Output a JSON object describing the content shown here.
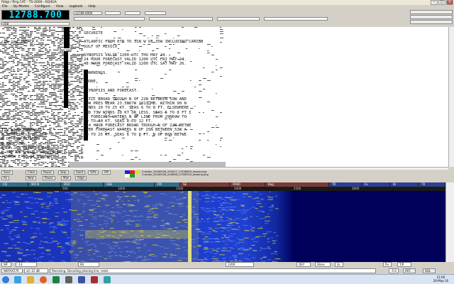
{
  "window": {
    "title": "fldigi / flrig CAT - TS-2000 - KQ4GA"
  },
  "menu": [
    "File",
    "Op Modes",
    "Configure",
    "View",
    "Logbook",
    "Help"
  ],
  "frequency": {
    "display": "12788.700",
    "mode": "USB",
    "field_freq": "12789.0000"
  },
  "faxtext": {
    "left_a": [
      "CAN SEA AND",
      "",
      "",
      "",
      "",
      "",
      "",
      "",
      "",
      "",
      "",
      "",
      "",
      "",
      "",
      "",
      "",
      "",
      "",
      "",
      "TIN WITH EMBEDDED",
      "N SEMICIRCLE OF LOW",
      "N OF 26N BETWEEN",
      "E AND 70W",
      "N OF 26N BETWEEN 64W",
      "N THE SE SHELL. REMAINDER",
      "20N08W E TO SE WINDS",
      "",
      "",
      "",
      "",
      "",
      "SECTION SAW AND",
      "SECTION 53W AND",
      "NAW AND 59W SE."
    ],
    "right": [
      "SECURITE",
      "",
      "ATLANTIC FROM 07N TO 31N W OF 35W INCLUDING CARIBB",
      "GULF OF MEXICO",
      "",
      "SYNOPSIS VALID 1200 UTC THU MAY 24.",
      "24 HOUR FORECAST VALID 1200 UTC FRI MAY 24.",
      "48 HOUR FORECAST VALID 1200 UTC SAT MAY 26.",
      "",
      ".WARNINGS.",
      "",
      ".NONE.",
      "",
      ".SYNOPSIS AND FORECAST.",
      "",
      ".ATLC BROAD TROUGH N OF 22N BETWEEN 59W AND",
      "LOW PRES NEAR 23.5N67W 1013 MB. WITHIN 90 N",
      "WINDS 20 TO 25 KT. SEAS 6 TO 8 FT. ELSEWHERE",
      "AND 73W WINDS 20 KT OR LESS. SEAS 5 TO 8 FT I",
      "OF FORECAST WATERS N OF LINE FROM 29N69W TO",
      "20 TO 30 KT. SEAS 8 TO 12 FT.",
      ".24 HOUR FORECAST BROAD TROUGH N OF 22N BETWE",
      "OVER FORECAST WATERS N OF 25N BETWEEN 53W A",
      "20 TO 25 KT. SEAS 6 TO 8 FT. N OF 26N BETWE"
    ]
  },
  "toolbar": {
    "save": "Save",
    "clear": "Clear",
    "pause": "Pause",
    "skip": "Skip",
    "slant": "Slant",
    "zoom": "Zoom",
    "zoom_val": "50%",
    "fm": "FM",
    "rx_label": "Rx",
    "new_label": "New",
    "pause_val": "Pause",
    "man_label": "Man",
    "align": "Align"
  },
  "files": [
    "3 wefax_20160526_203417_17438000_moore.png",
    "3 wefax_20160526_204636_12788700_phasing.png"
  ],
  "bands": [
    {
      "label": "CQ",
      "color": "#2f6f8f"
    },
    {
      "label": "WX N",
      "color": "#2f6f8f"
    },
    {
      "label": "DSO",
      "color": "#2f6f8f"
    },
    {
      "label": "SSB",
      "color": "#2f6f8f"
    },
    {
      "label": "FM",
      "color": "#2f6f8f"
    },
    {
      "label": "SE",
      "color": "#7a3a3a"
    },
    {
      "label": "FM40",
      "color": "#7a3a3a"
    },
    {
      "label": "Bag",
      "color": "#7a3a3a"
    },
    {
      "label": "TR",
      "color": "#2f3f8f"
    },
    {
      "label": "Fx",
      "color": "#2f3f8f"
    },
    {
      "label": "Br",
      "color": "#2f3f8f"
    },
    {
      "label": "TX",
      "color": "#2f3f8f"
    }
  ],
  "ruler": [
    "500",
    "1000",
    "1500",
    "2000",
    "2500",
    "3000"
  ],
  "controls": {
    "wf_label": "WF",
    "level": "-13",
    "val1": "60",
    "val2": "1200",
    "qsy": "QSY",
    "store": "Store",
    "lk": "Lk",
    "rv": "Rv",
    "t_r": "T/R"
  },
  "status": {
    "mode": "WEFAX576",
    "sn": "s/n 12 dB",
    "msg": "Receiving. Decoding phasing line, reset.",
    "val": "-5.0",
    "afc": "AFC",
    "sql": "SQL"
  },
  "clock": {
    "time": "21:00",
    "date": "26-May-16"
  }
}
